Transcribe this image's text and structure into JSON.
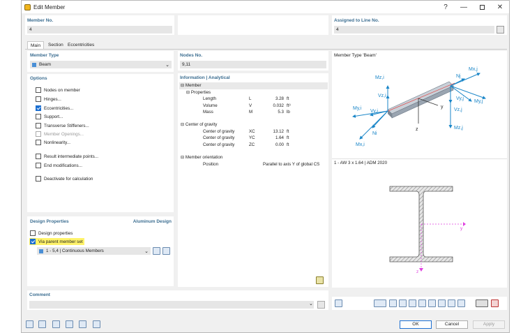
{
  "window": {
    "title": "Edit Member"
  },
  "top": {
    "member_no_label": "Member No.",
    "member_no_value": "4",
    "assigned_label": "Assigned to Line No.",
    "assigned_value": "4"
  },
  "tabs": [
    "Main",
    "Section",
    "Eccentricities"
  ],
  "member_type": {
    "label": "Member Type",
    "value": "Beam"
  },
  "options": {
    "label": "Options",
    "items": [
      {
        "label": "Nodes on member",
        "checked": false
      },
      {
        "label": "Hinges...",
        "checked": false
      },
      {
        "label": "Eccentricities...",
        "checked": true
      },
      {
        "label": "Support...",
        "checked": false
      },
      {
        "label": "Transverse Stiffeners...",
        "checked": false
      },
      {
        "label": "Member Openings...",
        "checked": false,
        "disabled": true
      },
      {
        "label": "Nonlinearity...",
        "checked": false
      },
      {
        "label": "Result intermediate points...",
        "checked": false
      },
      {
        "label": "End modifications...",
        "checked": false
      },
      {
        "label": "Deactivate for calculation",
        "checked": false
      }
    ]
  },
  "design": {
    "label": "Design Properties",
    "right_label": "Aluminum Design",
    "design_properties": "Design properties",
    "via_parent": "Via parent member set",
    "member_set": "1 - 5,4 | Continuous Members"
  },
  "nodes": {
    "label": "Nodes No.",
    "value": "9,11"
  },
  "info": {
    "label": "Information | Analytical",
    "member": "Member",
    "properties": "Properties",
    "rows": [
      {
        "name": "Length",
        "sym": "L",
        "val": "3.28",
        "unit": "ft"
      },
      {
        "name": "Volume",
        "sym": "V",
        "val": "0.032",
        "unit": "ft³"
      },
      {
        "name": "Mass",
        "sym": "M",
        "val": "5.3",
        "unit": "lb"
      }
    ],
    "cog": "Center of gravity",
    "cog_rows": [
      {
        "name": "Center of gravity",
        "sym": "XC",
        "val": "13.12",
        "unit": "ft"
      },
      {
        "name": "Center of gravity",
        "sym": "YC",
        "val": "1.64",
        "unit": "ft"
      },
      {
        "name": "Center of gravity",
        "sym": "ZC",
        "val": "0.00",
        "unit": "ft"
      }
    ],
    "orientation": "Member orientation",
    "position_name": "Position",
    "position_val": "Parallel to axis Y of global CS"
  },
  "preview": {
    "title": "Member Type 'Beam'",
    "section": "1 - AW 3 x 1.64 | ADM 2020",
    "labels": {
      "mzi": "Mz,i",
      "vzi": "Vz,i",
      "myi": "My,i",
      "vyi": "Vy,i",
      "ni": "Ni",
      "mxi": "Mx,i",
      "mxj": "Mx,j",
      "nj": "Nj",
      "vyj": "Vy,j",
      "myj": "My,j",
      "vzj": "Vz,j",
      "mzj": "Mz,j",
      "y": "y",
      "z": "z"
    },
    "axis_y": "y",
    "axis_z": "z"
  },
  "comment": {
    "label": "Comment",
    "value": ""
  },
  "buttons": {
    "ok": "OK",
    "cancel": "Cancel",
    "apply": "Apply"
  },
  "colors": {
    "accent": "#1c6fd1",
    "header": "#3c6e91",
    "arrow": "#1a86c8",
    "highlight": "#fff36a",
    "magenta": "#e040e0"
  }
}
